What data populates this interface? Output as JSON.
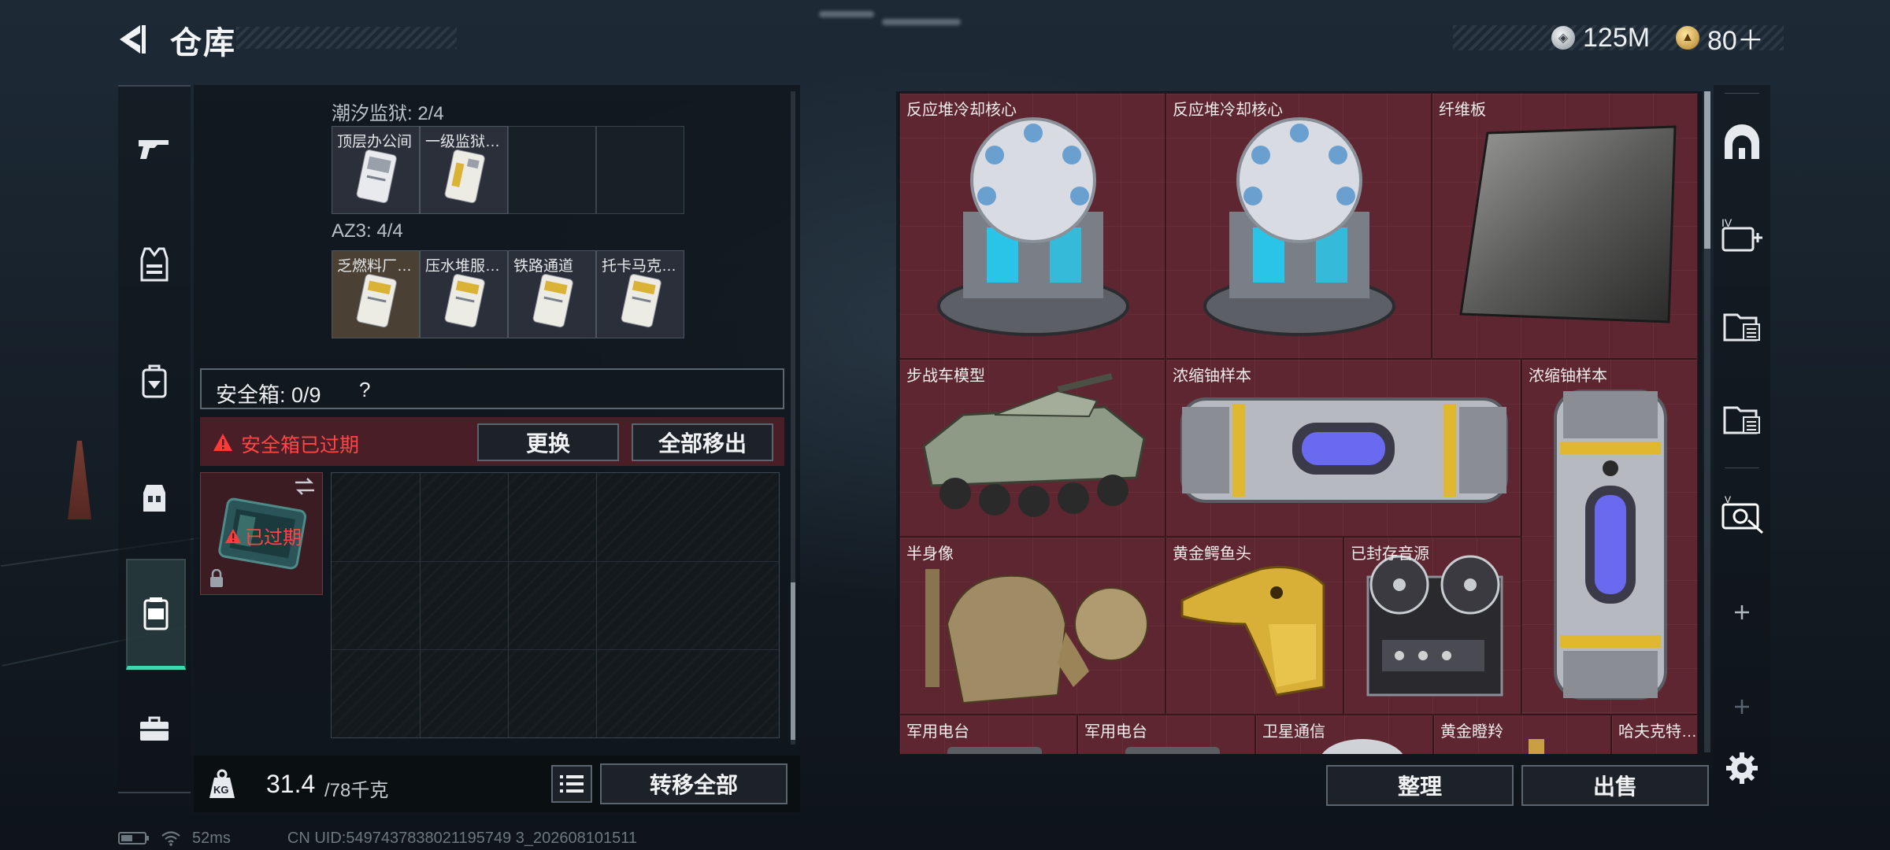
{
  "header": {
    "title": "仓库"
  },
  "currency": [
    {
      "value": "125M",
      "icon": "silver-coin-icon",
      "color": "#c7ccd1"
    },
    {
      "value": "80＋",
      "icon": "gold-coin-icon",
      "color": "#d9b25a"
    }
  ],
  "left_rail": [
    {
      "icon": "gun-icon",
      "active": false
    },
    {
      "icon": "armor-vest-icon",
      "active": false
    },
    {
      "icon": "backpack-icon",
      "active": false
    },
    {
      "icon": "chest-rig-icon",
      "active": false
    },
    {
      "icon": "safebox-icon",
      "active": true
    },
    {
      "icon": "toolbox-icon",
      "active": false
    }
  ],
  "key_groups": [
    {
      "title": "潮汐监狱: 2/4",
      "keys": [
        "顶层办公间",
        "一级监狱…"
      ]
    },
    {
      "title": "AZ3: 4/4",
      "keys": [
        "乏燃料厂…",
        "压水堆服…",
        "铁路通道",
        "托卡马克…"
      ]
    }
  ],
  "safebox": {
    "title": "安全箱: 0/9",
    "help": "?",
    "warning": "安全箱已过期",
    "replace_label": "更换",
    "move_all_label": "全部移出",
    "case_status": "已过期"
  },
  "footer_left": {
    "weight_current": "31.4",
    "weight_max": "/78千克",
    "kg_icon_text": "KG",
    "transfer_all_label": "转移全部"
  },
  "stash_items": [
    {
      "name": "反应堆冷却核心",
      "art": "reactor"
    },
    {
      "name": "反应堆冷却核心",
      "art": "reactor"
    },
    {
      "name": "纤维板",
      "art": "fiberboard"
    },
    {
      "name": "步战车模型",
      "art": "ifv"
    },
    {
      "name": "浓缩铀样本",
      "art": "capsule-h"
    },
    {
      "name": "浓缩铀样本",
      "art": "capsule-v"
    },
    {
      "name": "半身像",
      "art": "bust"
    },
    {
      "name": "黄金鳄鱼头",
      "art": "croc"
    },
    {
      "name": "已封存音源",
      "art": "reel"
    },
    {
      "name": "军用电台",
      "art": "none"
    },
    {
      "name": "军用电台",
      "art": "none"
    },
    {
      "name": "卫星通信",
      "art": "none"
    },
    {
      "name": "黄金瞪羚",
      "art": "none"
    },
    {
      "name": "哈夫克特…",
      "art": "none"
    }
  ],
  "footer_right": {
    "sort_label": "整理",
    "sell_label": "出售"
  },
  "right_rail": [
    {
      "icon": "safehouse-icon"
    },
    {
      "icon": "add-container-iv-icon"
    },
    {
      "icon": "folder-list-icon"
    },
    {
      "icon": "folder-list-icon"
    },
    {
      "icon": "sell-tag-icon"
    },
    {
      "icon": "plus-icon"
    },
    {
      "icon": "plus-icon"
    },
    {
      "icon": "settings-gear-icon"
    }
  ],
  "status": {
    "ping": "52ms",
    "uid": "CN UID:5497437838021195749 3_202608101511"
  }
}
